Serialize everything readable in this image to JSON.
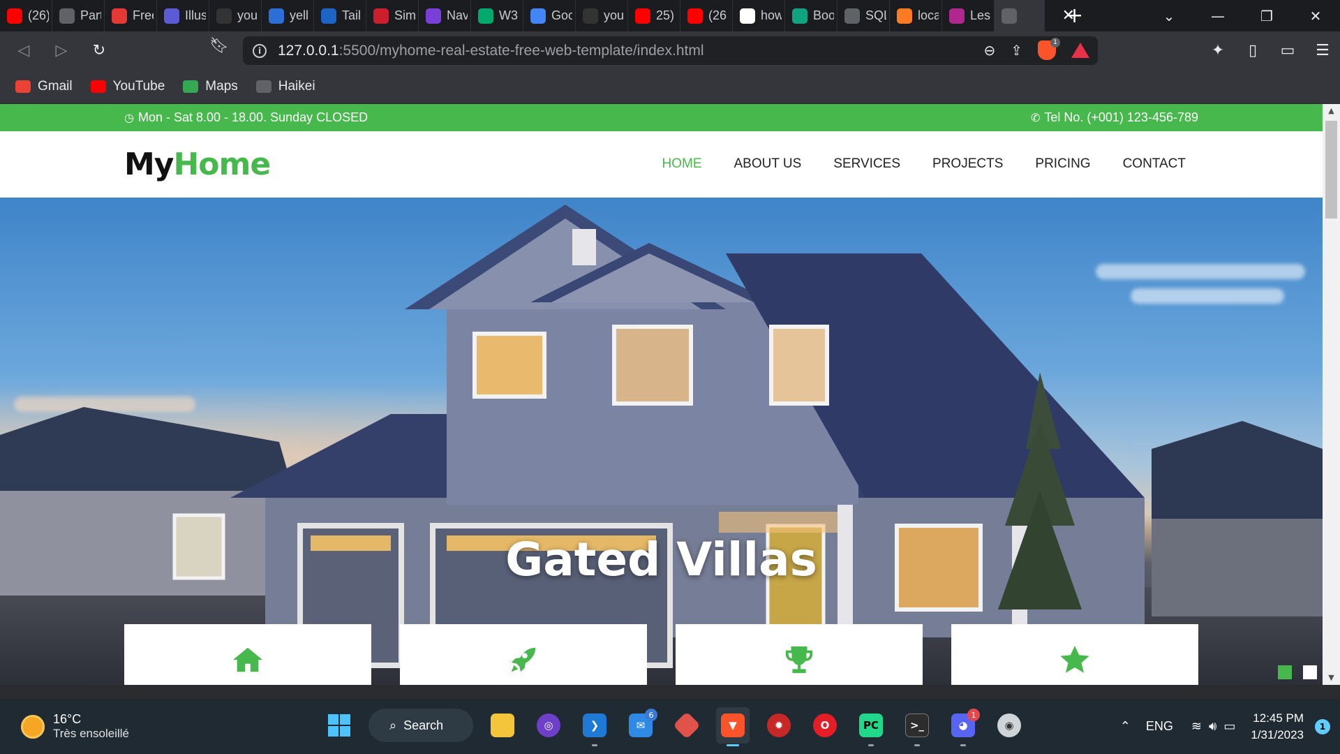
{
  "browser": {
    "tabs": [
      {
        "title": "(26)",
        "icon": "youtube-icon",
        "color": "#ff0000"
      },
      {
        "title": "Part",
        "icon": "globe-icon",
        "color": "#5f6368"
      },
      {
        "title": "Free",
        "icon": "s-icon",
        "color": "#e53935"
      },
      {
        "title": "Illus",
        "icon": "illustration-icon",
        "color": "#5b5bd6"
      },
      {
        "title": "you",
        "icon": "github-icon",
        "color": "#333333"
      },
      {
        "title": "yell",
        "icon": "c-icon",
        "color": "#2b6fd6"
      },
      {
        "title": "Tail",
        "icon": "tailwind-icon",
        "color": "#1e63c6"
      },
      {
        "title": "Sim",
        "icon": "simple-icon",
        "color": "#cc1f2e"
      },
      {
        "title": "Nav",
        "icon": "bootstrap-icon",
        "color": "#7a3fd6"
      },
      {
        "title": "W3",
        "icon": "w3-icon",
        "color": "#04aa6d"
      },
      {
        "title": "Goo",
        "icon": "translate-icon",
        "color": "#4285f4"
      },
      {
        "title": "you",
        "icon": "github-icon",
        "color": "#333333"
      },
      {
        "title": "25)",
        "icon": "youtube-icon",
        "color": "#ff0000"
      },
      {
        "title": "(26",
        "icon": "youtube-icon",
        "color": "#ff0000"
      },
      {
        "title": "how",
        "icon": "google-icon",
        "color": "#ffffff"
      },
      {
        "title": "Boo",
        "icon": "chatgpt-icon",
        "color": "#10a37f"
      },
      {
        "title": "SQL",
        "icon": "globe-icon",
        "color": "#5f6368"
      },
      {
        "title": "loca",
        "icon": "xampp-icon",
        "color": "#fb7a24"
      },
      {
        "title": "Les",
        "icon": "stb-icon",
        "color": "#b0278f"
      },
      {
        "title": "",
        "icon": "globe-icon",
        "color": "#5f6368"
      }
    ],
    "url_host": "127.0.0.1",
    "url_path": ":5500/myhome-real-estate-free-web-template/index.html",
    "rewards_badge": "1",
    "bookmarks": [
      {
        "label": "Gmail",
        "icon": "gmail-icon",
        "color": "#ea4335"
      },
      {
        "label": "YouTube",
        "icon": "youtube-icon",
        "color": "#ff0000"
      },
      {
        "label": "Maps",
        "icon": "maps-icon",
        "color": "#34a853"
      },
      {
        "label": "Haikei",
        "icon": "globe-icon",
        "color": "#5f6368"
      }
    ]
  },
  "page": {
    "hours": "Mon - Sat 8.00 - 18.00. Sunday CLOSED",
    "phone": "Tel No. (+001) 123-456-789",
    "logo_my": "My",
    "logo_home": "Home",
    "nav": [
      "HOME",
      "ABOUT US",
      "SERVICES",
      "PROJECTS",
      "PRICING",
      "CONTACT"
    ],
    "slider_title": "Gated Villas",
    "slider_dots": 2,
    "active_dot": 1,
    "feature_icons": [
      "home-icon",
      "rocket-icon",
      "trophy-icon",
      "star-icon"
    ],
    "accent_color": "#47b94c"
  },
  "taskbar": {
    "temperature": "16°C",
    "weather": "Très ensoleillé",
    "search_label": "Search",
    "mail_badge": "6",
    "discord_badge": "1",
    "language": "ENG",
    "time": "12:45 PM",
    "date": "1/31/2023",
    "notifications": "1"
  }
}
